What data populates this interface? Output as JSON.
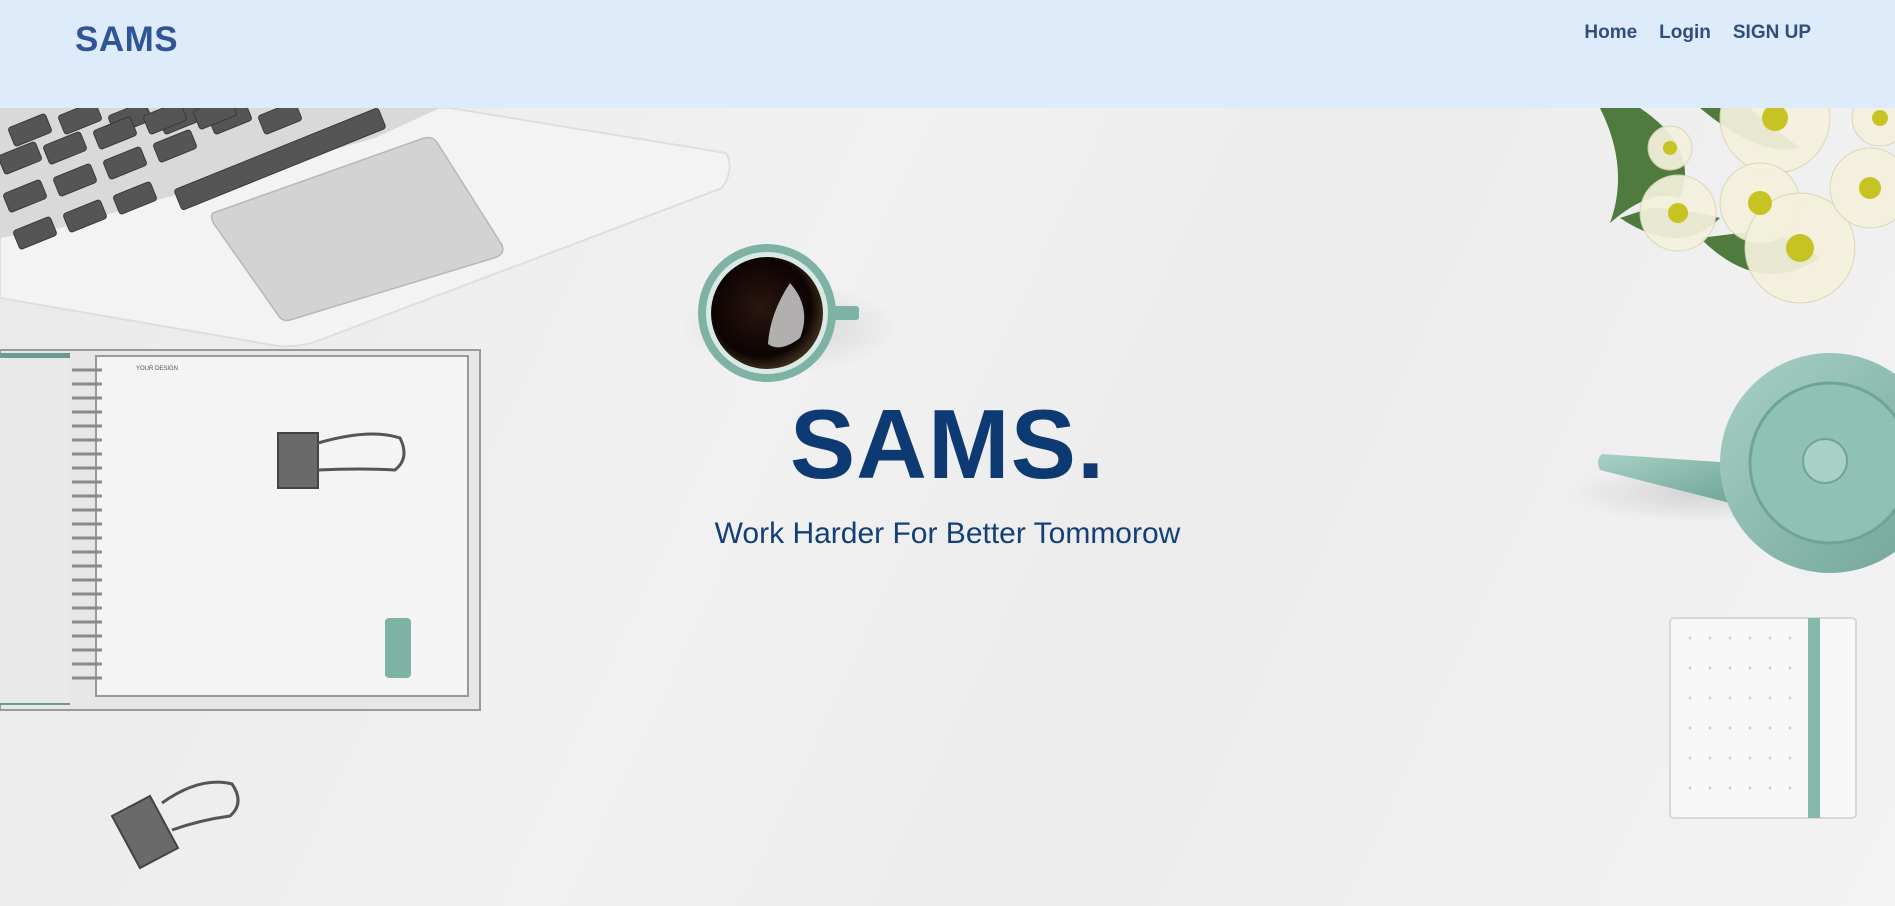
{
  "navbar": {
    "brand": "SAMS",
    "links": [
      {
        "label": "Home"
      },
      {
        "label": "Login"
      },
      {
        "label": "SIGN UP"
      }
    ]
  },
  "hero": {
    "title": "SAMS.",
    "subtitle": "Work Harder For Better Tommorow",
    "notebook_caption": "YOUR DESIGN"
  },
  "colors": {
    "navbar_bg": "#deebfb",
    "brand": "#2f5597",
    "title": "#0e3a73",
    "accent_teal": "#86b8ac"
  },
  "icons": [
    "laptop-illustration",
    "coffee-cup-illustration",
    "flowers-illustration",
    "teapot-illustration",
    "notebook-illustration",
    "binder-clip-icon",
    "note-pad-illustration"
  ]
}
